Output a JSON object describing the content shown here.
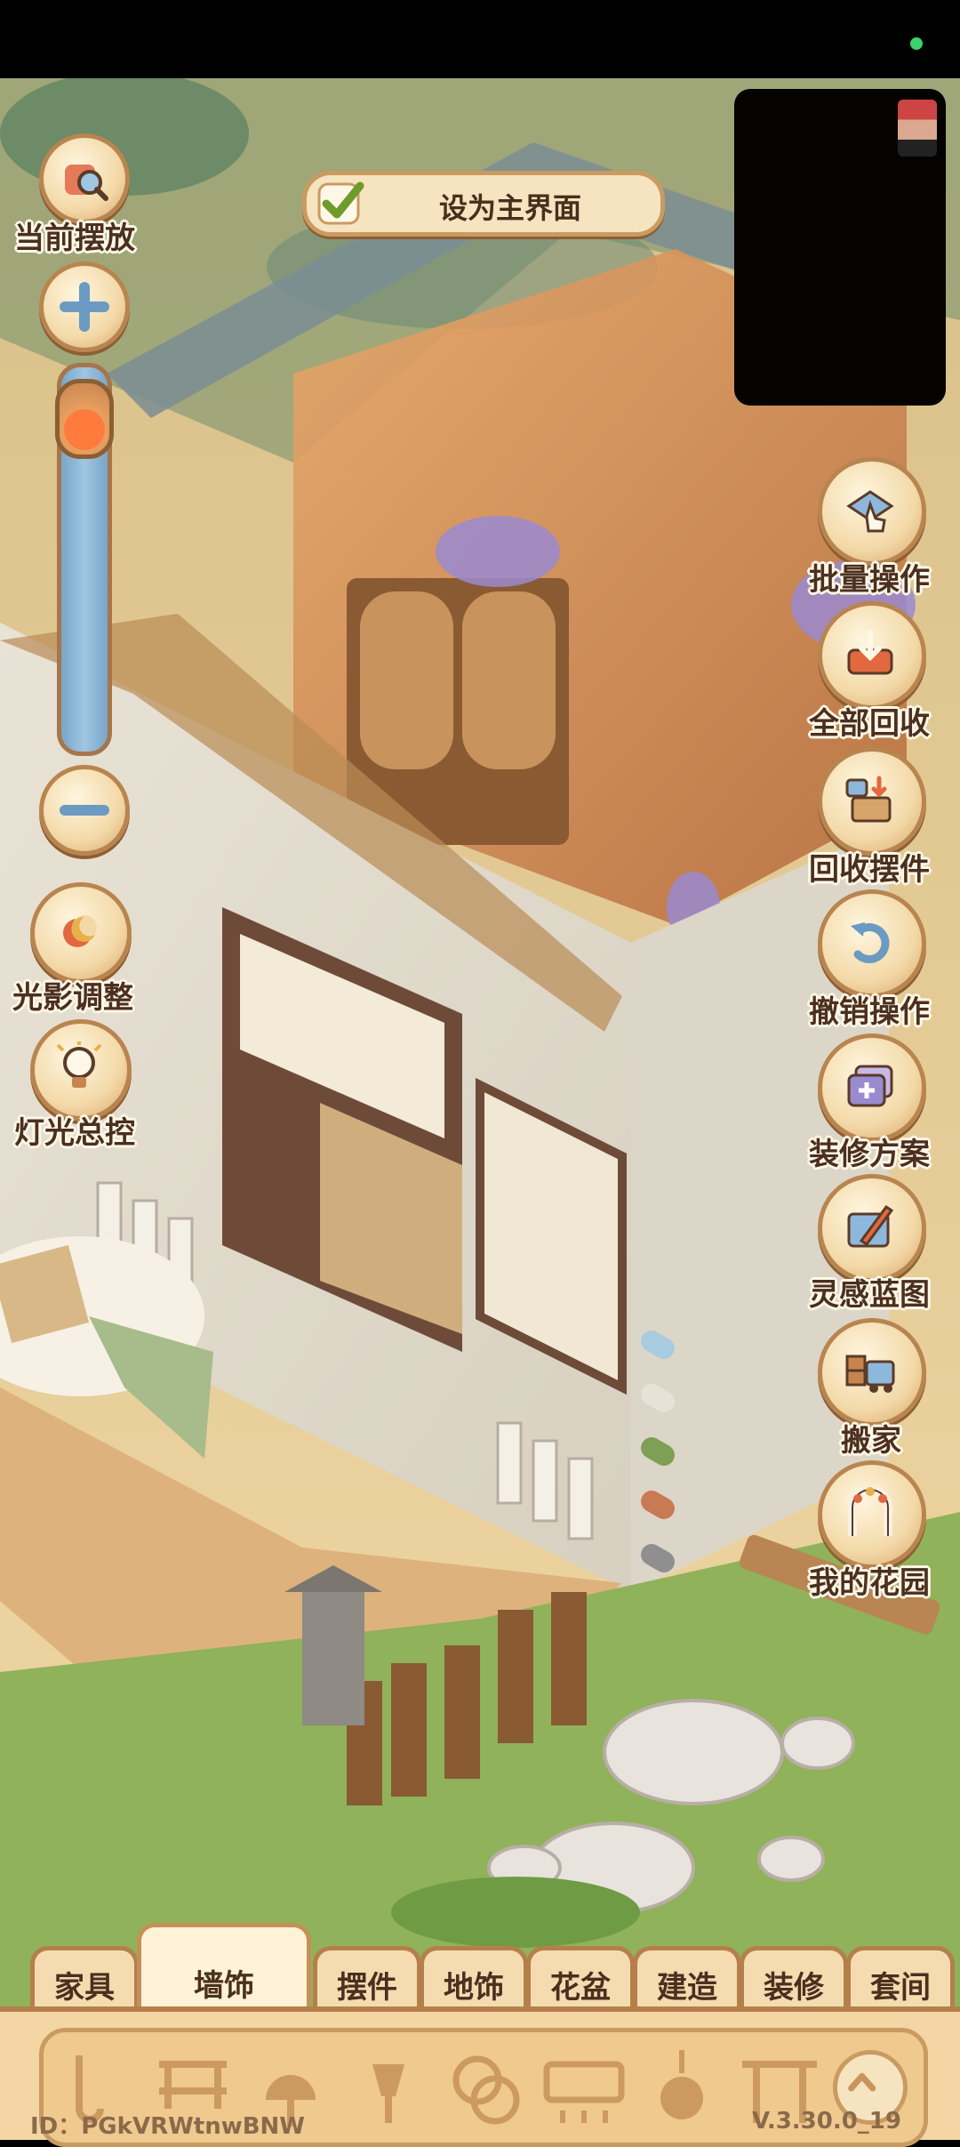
{
  "left_controls": {
    "current_placement": "当前摆放",
    "lighting_adjust": "光影调整",
    "light_master": "灯光总控"
  },
  "set_as_main": "设为主界面",
  "zoom": {
    "level": 0.05
  },
  "right_actions": [
    {
      "label": "批量操作",
      "icon": "batch-hand-icon"
    },
    {
      "label": "全部回收",
      "icon": "recycle-tray-icon"
    },
    {
      "label": "回收摆件",
      "icon": "recycle-box-icon"
    },
    {
      "label": "撤销操作",
      "icon": "undo-arrow-icon"
    },
    {
      "label": "装修方案",
      "icon": "decor-plan-icon"
    },
    {
      "label": "灵感蓝图",
      "icon": "blueprint-pencil-icon"
    },
    {
      "label": "搬家",
      "icon": "moving-truck-icon"
    },
    {
      "label": "我的花园",
      "icon": "garden-arch-icon"
    }
  ],
  "tabs": [
    "家具",
    "墙饰",
    "摆件",
    "地饰",
    "花盆",
    "建造",
    "装修",
    "套间"
  ],
  "active_tab": "墙饰",
  "footer": {
    "id": "ID：PGkVRWtnwBNW",
    "version": "V.3.30.0_19"
  },
  "colors": {
    "accent_brown": "#b57f4b",
    "panel": "#f3d6a3",
    "grass": "#8fb25a"
  }
}
